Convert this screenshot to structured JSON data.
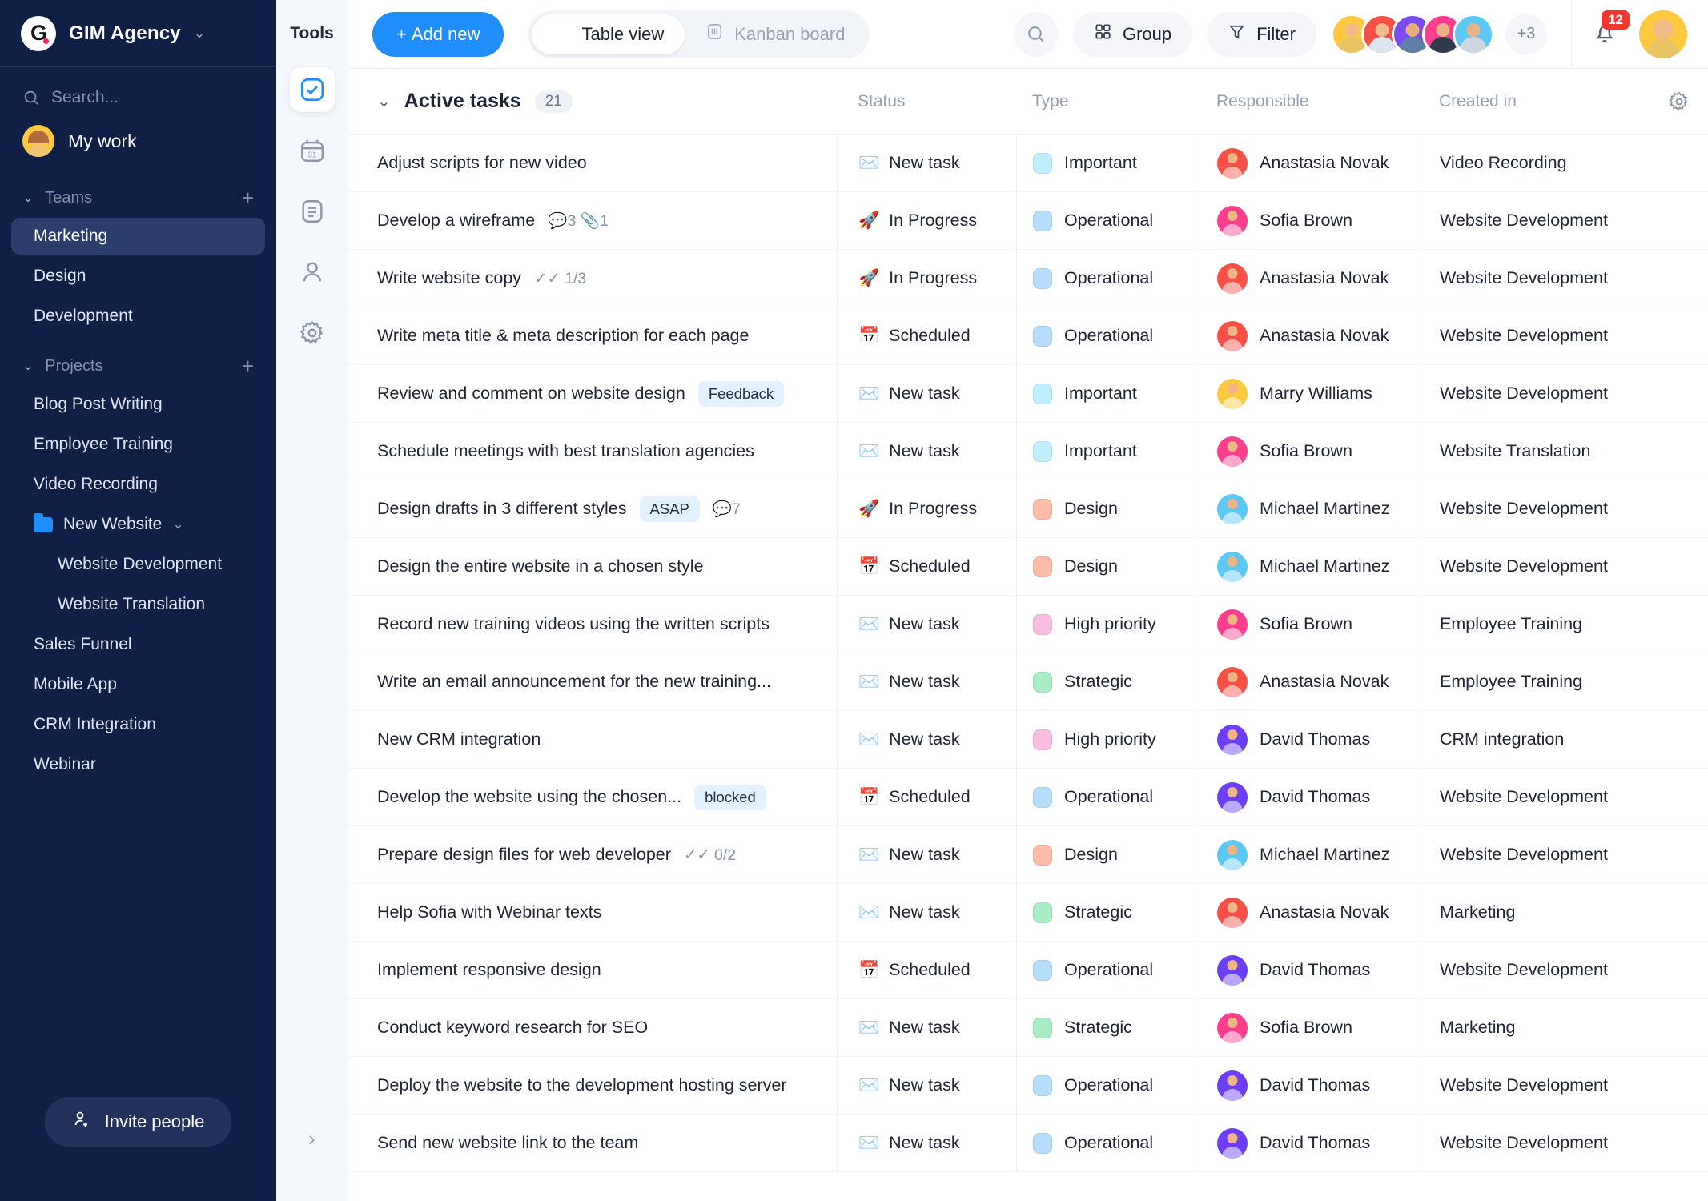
{
  "sidebar": {
    "brand": {
      "logo_letter": "G",
      "name": "GIM Agency",
      "chevron": "⌄"
    },
    "search": {
      "placeholder": "Search..."
    },
    "my_work": {
      "label": "My work"
    },
    "teams": {
      "header": "Teams",
      "add": "+",
      "items": [
        {
          "label": "Marketing",
          "active": true
        },
        {
          "label": "Design",
          "active": false
        },
        {
          "label": "Development",
          "active": false
        }
      ]
    },
    "projects": {
      "header": "Projects",
      "add": "+",
      "items": [
        {
          "label": "Blog Post Writing",
          "type": "item"
        },
        {
          "label": "Employee Training",
          "type": "item"
        },
        {
          "label": "Video Recording",
          "type": "item"
        },
        {
          "label": "New Website",
          "type": "folder",
          "chevron": "⌄"
        },
        {
          "label": "Website Development",
          "type": "sub"
        },
        {
          "label": "Website Translation",
          "type": "sub"
        },
        {
          "label": "Sales Funnel",
          "type": "item"
        },
        {
          "label": "Mobile App",
          "type": "item"
        },
        {
          "label": "CRM Integration",
          "type": "item"
        },
        {
          "label": "Webinar",
          "type": "item"
        }
      ]
    },
    "invite": {
      "label": "Invite people"
    }
  },
  "tools": {
    "label": "Tools",
    "items": [
      {
        "icon": "tasks-check-icon",
        "active": true
      },
      {
        "icon": "calendar-icon",
        "active": false
      },
      {
        "icon": "document-icon",
        "active": false
      },
      {
        "icon": "person-icon",
        "active": false
      },
      {
        "icon": "settings-gear-icon",
        "active": false
      }
    ],
    "expand": "›"
  },
  "topbar": {
    "add_new": "Add new",
    "views": [
      {
        "label": "Table view",
        "active": true
      },
      {
        "label": "Kanban board",
        "active": false
      }
    ],
    "group": "Group",
    "filter": "Filter",
    "avatars_overflow": "+3",
    "notifications_count": "12"
  },
  "table": {
    "group_title": "Active tasks",
    "group_count": "21",
    "columns": [
      "Status",
      "Type",
      "Responsible",
      "Created in"
    ],
    "rows": [
      {
        "title": "Adjust scripts for new video",
        "tag": "",
        "meta": "",
        "status": "New task",
        "status_icon": "✉️",
        "type": "Important",
        "type_color": "#bdeefc",
        "responsible": "Anastasia Novak",
        "avatar_bg": "#f75147",
        "created": "Video Recording"
      },
      {
        "title": "Develop a wireframe",
        "tag": "",
        "meta": "💬3  📎1",
        "status": "In Progress",
        "status_icon": "🚀",
        "type": "Operational",
        "type_color": "#b6ddfa",
        "responsible": "Sofia Brown",
        "avatar_bg": "#fb3e8e",
        "created": "Website Development"
      },
      {
        "title": "Write website copy",
        "tag": "",
        "meta": "✓✓ 1/3",
        "status": "In Progress",
        "status_icon": "🚀",
        "type": "Operational",
        "type_color": "#b6ddfa",
        "responsible": "Anastasia Novak",
        "avatar_bg": "#f75147",
        "created": "Website Development"
      },
      {
        "title": "Write meta title & meta description for each page",
        "tag": "",
        "meta": "",
        "status": "Scheduled",
        "status_icon": "📅",
        "type": "Operational",
        "type_color": "#b6ddfa",
        "responsible": "Anastasia Novak",
        "avatar_bg": "#f75147",
        "created": "Website Development"
      },
      {
        "title": "Review and comment on website design",
        "tag": "Feedback",
        "meta": "",
        "status": "New task",
        "status_icon": "✉️",
        "type": "Important",
        "type_color": "#bdeefc",
        "responsible": "Marry Williams",
        "avatar_bg": "#ffc93f",
        "created": "Website Development"
      },
      {
        "title": "Schedule meetings with best translation agencies",
        "tag": "",
        "meta": "",
        "status": "New task",
        "status_icon": "✉️",
        "type": "Important",
        "type_color": "#bdeefc",
        "responsible": "Sofia Brown",
        "avatar_bg": "#fb3e8e",
        "created": "Website Translation"
      },
      {
        "title": "Design drafts in 3 different styles",
        "tag": "ASAP",
        "meta": "💬7",
        "status": "In Progress",
        "status_icon": "🚀",
        "type": "Design",
        "type_color": "#fcbda8",
        "responsible": "Michael Martinez",
        "avatar_bg": "#5bc8f5",
        "created": "Website Development"
      },
      {
        "title": "Design the entire website in a chosen style",
        "tag": "",
        "meta": "",
        "status": "Scheduled",
        "status_icon": "📅",
        "type": "Design",
        "type_color": "#fcbda8",
        "responsible": "Michael Martinez",
        "avatar_bg": "#5bc8f5",
        "created": "Website Development"
      },
      {
        "title": "Record new training videos using the written scripts",
        "tag": "",
        "meta": "",
        "status": "New task",
        "status_icon": "✉️",
        "type": "High priority",
        "type_color": "#f9bde0",
        "responsible": "Sofia Brown",
        "avatar_bg": "#fb3e8e",
        "created": "Employee Training"
      },
      {
        "title": "Write an email announcement for the new training...",
        "tag": "",
        "meta": "",
        "status": "New task",
        "status_icon": "✉️",
        "type": "Strategic",
        "type_color": "#a9ecc6",
        "responsible": "Anastasia Novak",
        "avatar_bg": "#f75147",
        "created": "Employee Training"
      },
      {
        "title": "New CRM integration",
        "tag": "",
        "meta": "",
        "status": "New task",
        "status_icon": "✉️",
        "type": "High priority",
        "type_color": "#f9bde0",
        "responsible": "David Thomas",
        "avatar_bg": "#6c3ef5",
        "created": "CRM integration"
      },
      {
        "title": "Develop the website using the chosen...",
        "tag": "blocked",
        "meta": "",
        "status": "Scheduled",
        "status_icon": "📅",
        "type": "Operational",
        "type_color": "#b6ddfa",
        "responsible": "David Thomas",
        "avatar_bg": "#6c3ef5",
        "created": "Website Development"
      },
      {
        "title": "Prepare design files for web developer",
        "tag": "",
        "meta": "✓✓ 0/2",
        "status": "New task",
        "status_icon": "✉️",
        "type": "Design",
        "type_color": "#fcbda8",
        "responsible": "Michael Martinez",
        "avatar_bg": "#5bc8f5",
        "created": "Website Development"
      },
      {
        "title": "Help Sofia with Webinar texts",
        "tag": "",
        "meta": "",
        "status": "New task",
        "status_icon": "✉️",
        "type": "Strategic",
        "type_color": "#a9ecc6",
        "responsible": "Anastasia Novak",
        "avatar_bg": "#f75147",
        "created": "Marketing"
      },
      {
        "title": "Implement responsive design",
        "tag": "",
        "meta": "",
        "status": "Scheduled",
        "status_icon": "📅",
        "type": "Operational",
        "type_color": "#b6ddfa",
        "responsible": "David Thomas",
        "avatar_bg": "#6c3ef5",
        "created": "Website Development"
      },
      {
        "title": "Conduct keyword research for SEO",
        "tag": "",
        "meta": "",
        "status": "New task",
        "status_icon": "✉️",
        "type": "Strategic",
        "type_color": "#a9ecc6",
        "responsible": "Sofia Brown",
        "avatar_bg": "#fb3e8e",
        "created": "Marketing"
      },
      {
        "title": "Deploy the website to the development hosting server",
        "tag": "",
        "meta": "",
        "status": "New task",
        "status_icon": "✉️",
        "type": "Operational",
        "type_color": "#b6ddfa",
        "responsible": "David Thomas",
        "avatar_bg": "#6c3ef5",
        "created": "Website Development"
      },
      {
        "title": "Send new website link to the team",
        "tag": "",
        "meta": "",
        "status": "New task",
        "status_icon": "✉️",
        "type": "Operational",
        "type_color": "#b6ddfa",
        "responsible": "David Thomas",
        "avatar_bg": "#6c3ef5",
        "created": "Website Development"
      }
    ]
  },
  "colors": {
    "sidebar_bg": "#101f45",
    "accent": "#1f8efa",
    "active_nav": "#2b3d6b",
    "badge_red": "#f1372f"
  }
}
